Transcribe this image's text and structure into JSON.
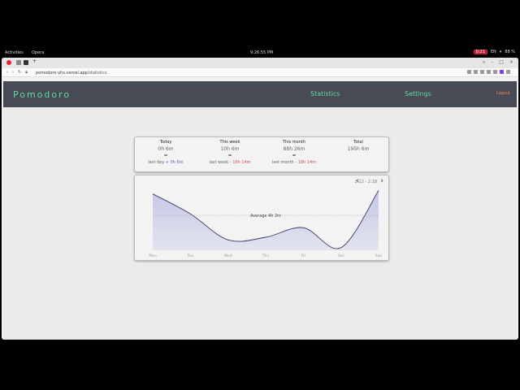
{
  "desktop": {
    "activities": "Activities",
    "app_name": "Opera",
    "clock": "9:26:55 PM",
    "recording": "0:21",
    "language": "EN",
    "battery": "88 %"
  },
  "browser": {
    "url_host": "pomodoro-yhs.vercel.app",
    "url_path": "/statistics"
  },
  "header": {
    "brand": "Pomodoro",
    "nav": [
      "Statistics",
      "Settings"
    ],
    "logout": "Logout"
  },
  "stats": [
    {
      "label": "Today",
      "value": "0h 6m",
      "eq": "=",
      "cmp_prefix": "last day",
      "cmp_sign": "+",
      "cmp_value": "0h 6m",
      "trend": "up"
    },
    {
      "label": "This week",
      "value": "10h 6m",
      "eq": "=",
      "cmp_prefix": "last week",
      "cmp_sign": "-",
      "cmp_value": "16h 14m",
      "trend": "down"
    },
    {
      "label": "This month",
      "value": "88h 26m",
      "eq": "=",
      "cmp_prefix": "last month",
      "cmp_sign": "-",
      "cmp_value": "18h 14m",
      "trend": "down"
    },
    {
      "label": "Total",
      "value": "195h 6m",
      "eq": "",
      "cmp_prefix": "",
      "cmp_sign": "",
      "cmp_value": "",
      "trend": ""
    }
  ],
  "chart": {
    "range_label": "2.12 - 2.18",
    "prev_label": "‹",
    "next_label": "›",
    "average_label": "Average 4h 2m",
    "line_color": "#3a3a6a",
    "fill_color": "#c5c8e6"
  },
  "chart_data": {
    "type": "area",
    "categories": [
      "Mon",
      "Tue",
      "Wed",
      "Thu",
      "Fri",
      "Sat",
      "Sun"
    ],
    "values": [
      6.5,
      4.2,
      1.2,
      1.5,
      2.6,
      0.3,
      6.9
    ],
    "average": 4.03,
    "ylim": [
      0,
      7.5
    ],
    "title": "",
    "xlabel": "",
    "ylabel": "",
    "grid": false
  }
}
